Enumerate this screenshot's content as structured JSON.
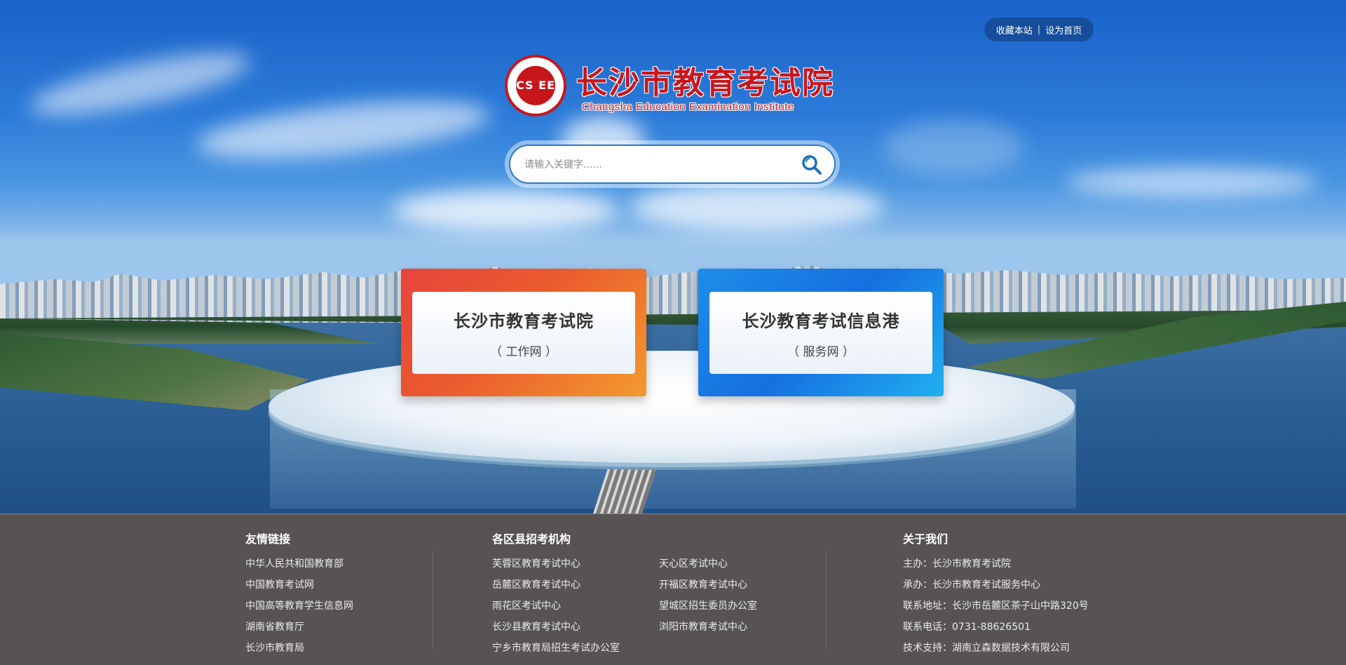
{
  "top_links": {
    "favorite": "收藏本站",
    "separator": "|",
    "homepage": "设为首页"
  },
  "logo": {
    "emblem_text": "CS EE",
    "title_cn": "长沙市教育考试院",
    "title_en": "Changsha Education Examination Institute"
  },
  "search": {
    "placeholder": "请输入关键字......",
    "value": "",
    "button_icon": "search-icon"
  },
  "cards": [
    {
      "title": "长沙市教育考试院",
      "subtitle": "（ 工作网 ）",
      "color": "#e9502f"
    },
    {
      "title": "长沙教育考试信息港",
      "subtitle": "（ 服务网 ）",
      "color": "#1a80e6"
    }
  ],
  "footer": {
    "friend_links": {
      "heading": "友情链接",
      "items": [
        "中华人民共和国教育部",
        "中国教育考试网",
        "中国高等教育学生信息网",
        "湖南省教育厅",
        "长沙市教育局"
      ]
    },
    "districts": {
      "heading": "各区县招考机构",
      "col1": [
        "芙蓉区教育考试中心",
        "岳麓区教育考试中心",
        "雨花区考试中心",
        "长沙县教育考试中心",
        "宁乡市教育局招生考试办公室"
      ],
      "col2": [
        "天心区考试中心",
        "开福区教育考试中心",
        "望城区招生委员办公室",
        "浏阳市教育考试中心"
      ]
    },
    "about": {
      "heading": "关于我们",
      "items": [
        "主办：长沙市教育考试院",
        "承办：长沙市教育考试服务中心",
        "联系地址：长沙市岳麓区茶子山中路320号",
        "联系电话：0731-88626501",
        "技术支持：湖南立森数据技术有限公司"
      ]
    }
  },
  "colors": {
    "brand_red": "#c8161d",
    "footer_bg": "#585353",
    "accent_blue": "#2b7ac9"
  }
}
